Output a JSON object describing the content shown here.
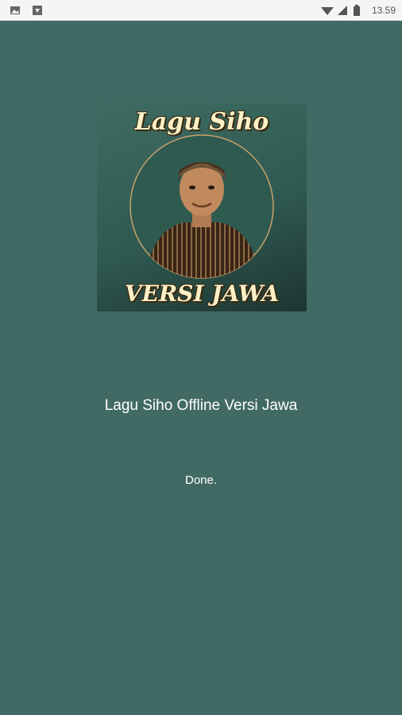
{
  "status_bar": {
    "time": "13.59",
    "left_icons": [
      "image-icon",
      "download-icon"
    ],
    "right_icons": [
      "wifi-icon",
      "signal-icon",
      "battery-icon"
    ]
  },
  "splash": {
    "image_title_top": "Lagu Siho",
    "image_title_bottom": "VERSI JAWA",
    "app_name": "Lagu Siho Offline Versi Jawa",
    "status": "Done."
  },
  "colors": {
    "background": "#426a65",
    "status_bar": "#f5f5f5",
    "text": "#ffffff"
  }
}
